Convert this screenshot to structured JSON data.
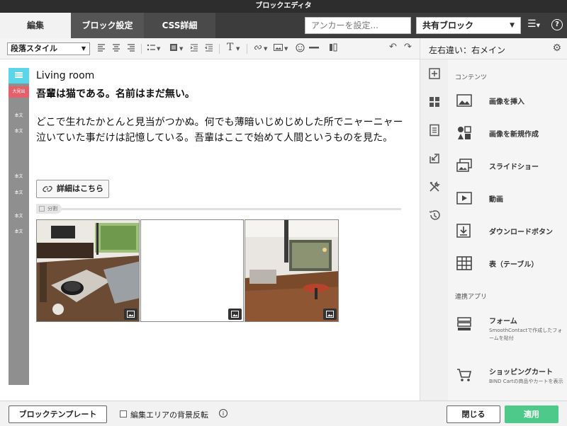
{
  "window": {
    "title": "ブロックエディタ"
  },
  "tabs": [
    {
      "label": "編集"
    },
    {
      "label": "ブロック設定"
    },
    {
      "label": "CSS詳細"
    }
  ],
  "header": {
    "anchor_placeholder": "アンカーを設定...",
    "shared_select_value": "共有ブロック"
  },
  "toolbar": {
    "paragraph_style": "段落スタイル"
  },
  "right_panel": {
    "title": "左右違い：右メイン",
    "section_contents": "コンテンツ",
    "items": [
      {
        "label": "画像を挿入"
      },
      {
        "label": "画像を新規作成"
      },
      {
        "label": "スライドショー"
      },
      {
        "label": "動画"
      },
      {
        "label": "ダウンロードボタン"
      },
      {
        "label": "表（テーブル）"
      }
    ],
    "section_apps": "連携アプリ",
    "apps": [
      {
        "label": "フォーム",
        "desc": "SmoothContactで作成したフォームを貼付"
      },
      {
        "label": "ショッピングカート",
        "desc": "BIND Cartの商品やカートを表示"
      }
    ]
  },
  "gutter": {
    "heading_label": "大見出",
    "body_label": "本文"
  },
  "editor": {
    "heading_en": "Living room",
    "heading_jp": "吾輩は猫である。名前はまだ無い。",
    "body": "どこで生れたかとんと見当がつかぬ。何でも薄暗いじめじめした所でニャーニャー泣いていた事だけは記憶している。吾輩はここで始めて人間というものを見た。",
    "detail_button": "詳細はこちら",
    "divider_label": "分割"
  },
  "footer": {
    "template_button": "ブロックテンプレート",
    "bg_invert_label": "編集エリアの背景反転",
    "close_button": "閉じる",
    "apply_button": "適用"
  },
  "colors": {
    "accent_green": "#4fc98a",
    "heading_marker": "#5ad6e8",
    "heading_badge": "#e4606a"
  }
}
